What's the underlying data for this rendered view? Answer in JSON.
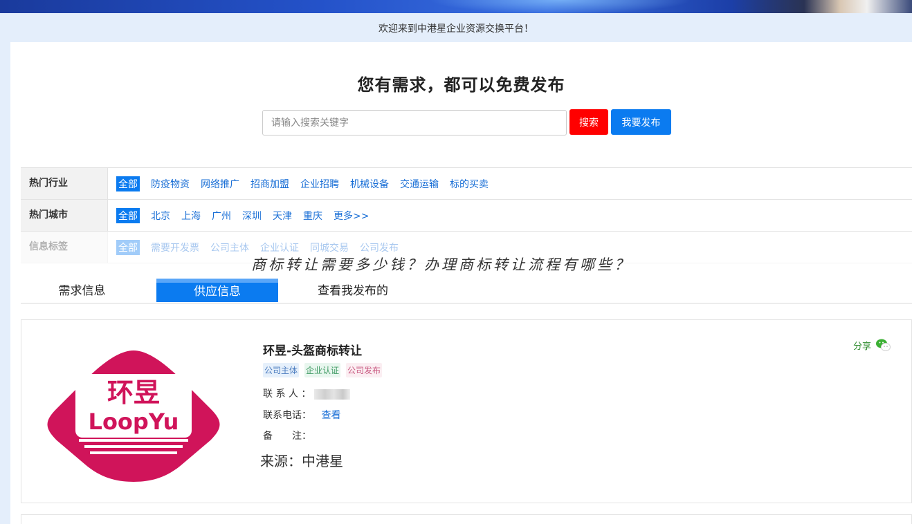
{
  "welcome_text": "欢迎来到中港星企业资源交换平台！",
  "hero": {
    "title": "您有需求，都可以免费发布"
  },
  "search": {
    "placeholder": "请输入搜索关键字",
    "search_label": "搜索",
    "publish_label": "我要发布"
  },
  "filters": {
    "industry": {
      "label": "热门行业",
      "options": [
        "全部",
        "防疫物资",
        "网络推广",
        "招商加盟",
        "企业招聘",
        "机械设备",
        "交通运输",
        "标的买卖"
      ]
    },
    "city": {
      "label": "热门城市",
      "options": [
        "全部",
        "北京",
        "上海",
        "广州",
        "深圳",
        "天津",
        "重庆",
        "更多>>"
      ]
    },
    "tags": {
      "label": "信息标签",
      "options": [
        "全部",
        "需要开发票",
        "公司主体",
        "企业认证",
        "同城交易",
        "公司发布"
      ]
    }
  },
  "overlay_caption": "商标转让需要多少钱？办理商标转让流程有哪些？",
  "tabs": [
    "需求信息",
    "供应信息",
    "查看我发布的"
  ],
  "listing": {
    "logo_text_cn": "环昱",
    "logo_text_en": "LoopYu",
    "title": "环昱-头盔商标转让",
    "tags": [
      "公司主体",
      "企业认证",
      "公司发布"
    ],
    "contact_label": "联 系 人 ：",
    "phone_label": "联系电话：",
    "phone_link": "查看",
    "remark_label": "备　　注：",
    "source": "来源：中港星",
    "share_label": "分享"
  },
  "colors": {
    "accent_blue": "#0b7bf0",
    "search_red": "#ff0000",
    "logo_crimson": "#d0145a"
  }
}
